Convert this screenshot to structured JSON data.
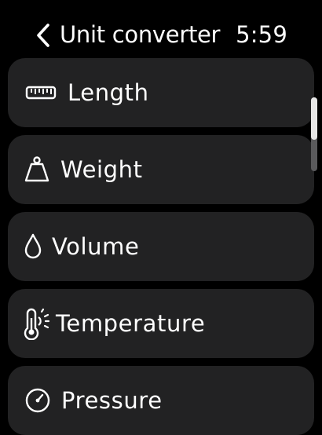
{
  "header": {
    "title": "Unit converter",
    "time": "5:59",
    "back_icon": "chevron-left-icon"
  },
  "items": [
    {
      "label": "Length",
      "icon": "ruler-icon"
    },
    {
      "label": "Weight",
      "icon": "weight-icon"
    },
    {
      "label": "Volume",
      "icon": "drop-icon"
    },
    {
      "label": "Temperature",
      "icon": "thermometer-sun-icon"
    },
    {
      "label": "Pressure",
      "icon": "gauge-icon"
    }
  ],
  "colors": {
    "background": "#000000",
    "row_background": "#222223",
    "text": "#ffffff"
  }
}
